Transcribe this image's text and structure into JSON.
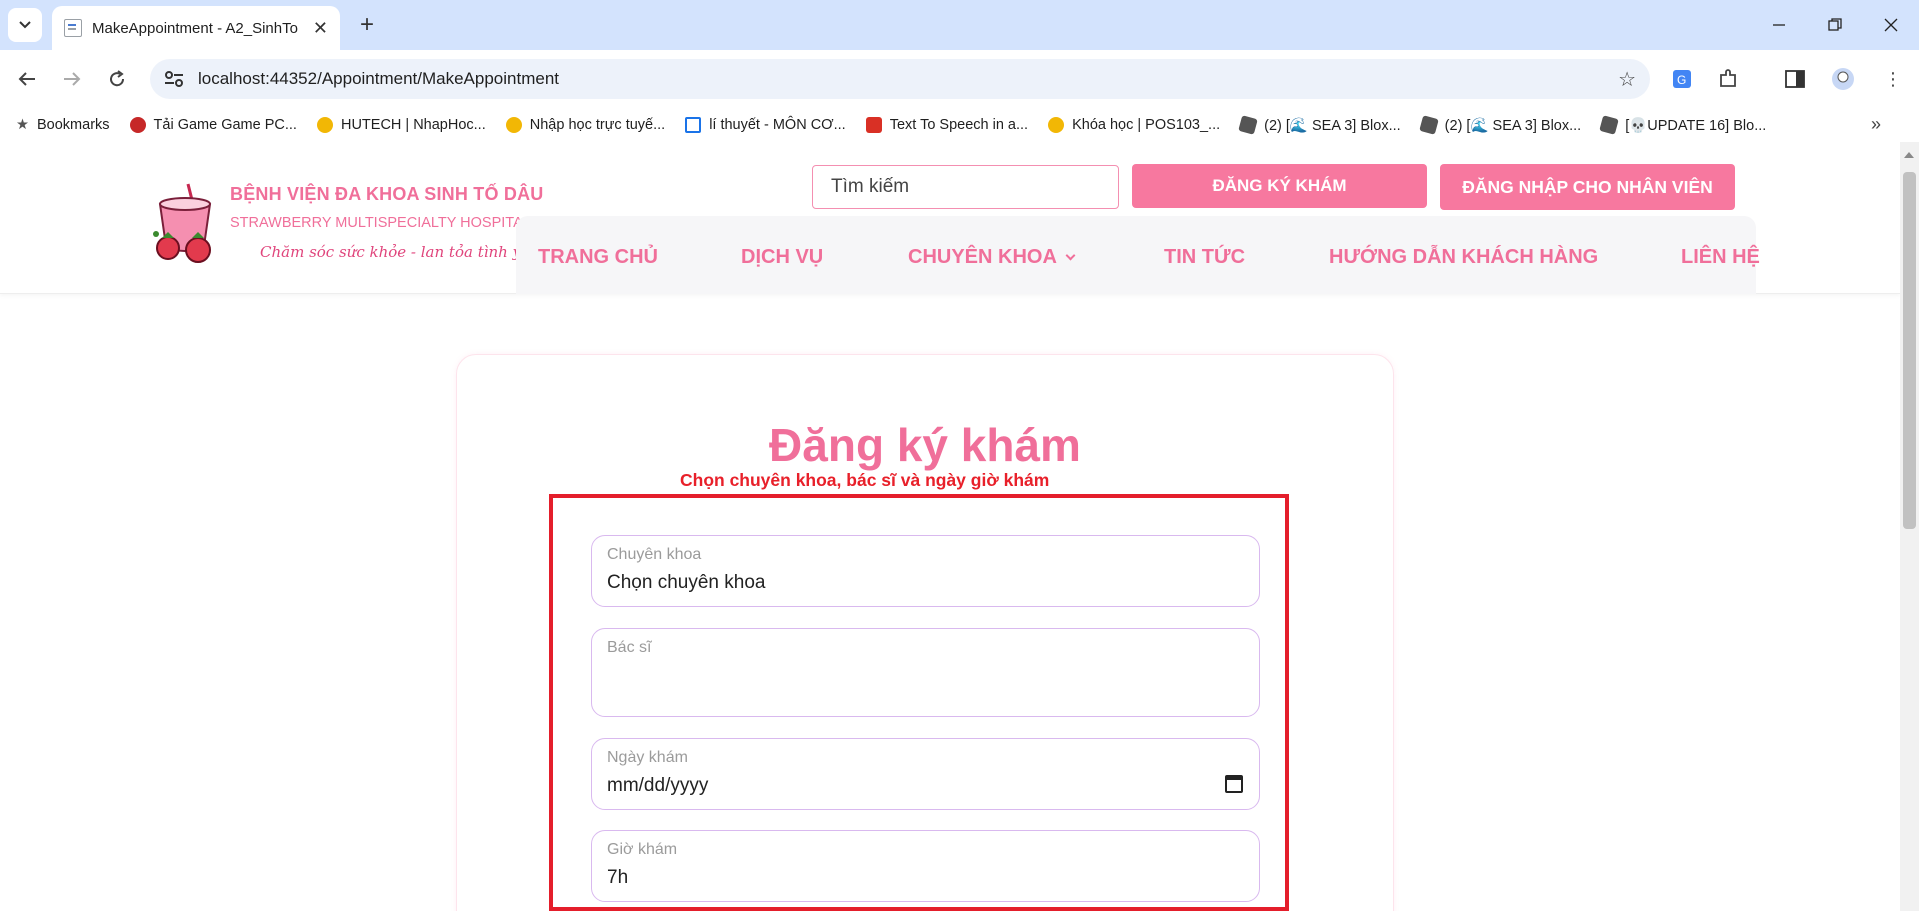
{
  "browser": {
    "tab_title": "MakeAppointment - A2_SinhTo",
    "url": "localhost:44352/Appointment/MakeAppointment",
    "bookmarks": [
      {
        "label": "Bookmarks",
        "color": "#555555"
      },
      {
        "label": "Tải Game Game PC...",
        "color": "#c62828"
      },
      {
        "label": "HUTECH | NhapHoc...",
        "color": "#f2b705"
      },
      {
        "label": "Nhập học trực tuyế...",
        "color": "#f2b705"
      },
      {
        "label": "lí thuyết - MÔN CƠ...",
        "color": "#1a73e8"
      },
      {
        "label": "Text To Speech in a...",
        "color": "#d93025"
      },
      {
        "label": "Khóa học | POS103_...",
        "color": "#f2b705"
      },
      {
        "label": "(2) [🌊 SEA 3] Blox...",
        "color": "#555555"
      },
      {
        "label": "(2) [🌊 SEA 3] Blox...",
        "color": "#555555"
      },
      {
        "label": "[💀UPDATE 16] Blo...",
        "color": "#555555"
      }
    ]
  },
  "site": {
    "brand_name": "BỆNH VIỆN ĐA KHOA SINH TỐ DÂU",
    "brand_sub": "STRAWBERRY MULTISPECIALTY HOSPITAL",
    "brand_slogan": "Chăm sóc sức khỏe - lan tỏa tình yêu",
    "search_placeholder": "Tìm kiếm",
    "register_button": "ĐĂNG KÝ KHÁM",
    "staff_login_button": "ĐĂNG NHẬP CHO NHÂN VIÊN",
    "nav": [
      "TRANG CHỦ",
      "DỊCH VỤ",
      "CHUYÊN KHOA",
      "TIN TỨC",
      "HƯỚNG DẪN KHÁCH HÀNG",
      "LIÊN HỆ"
    ]
  },
  "form": {
    "title": "Đăng ký khám",
    "annotation": "Chọn chuyên khoa, bác sĩ và ngày giờ khám",
    "fields": {
      "specialty": {
        "label": "Chuyên khoa",
        "value": "Chọn chuyên khoa"
      },
      "doctor": {
        "label": "Bác sĩ",
        "value": ""
      },
      "date": {
        "label": "Ngày khám",
        "value": "mm/dd/yyyy"
      },
      "time": {
        "label": "Giờ khám",
        "value": "7h"
      }
    }
  },
  "colors": {
    "brand_pink": "#f06f9a",
    "button_pink": "#f7789f",
    "annotation_red": "#e41e2b"
  }
}
